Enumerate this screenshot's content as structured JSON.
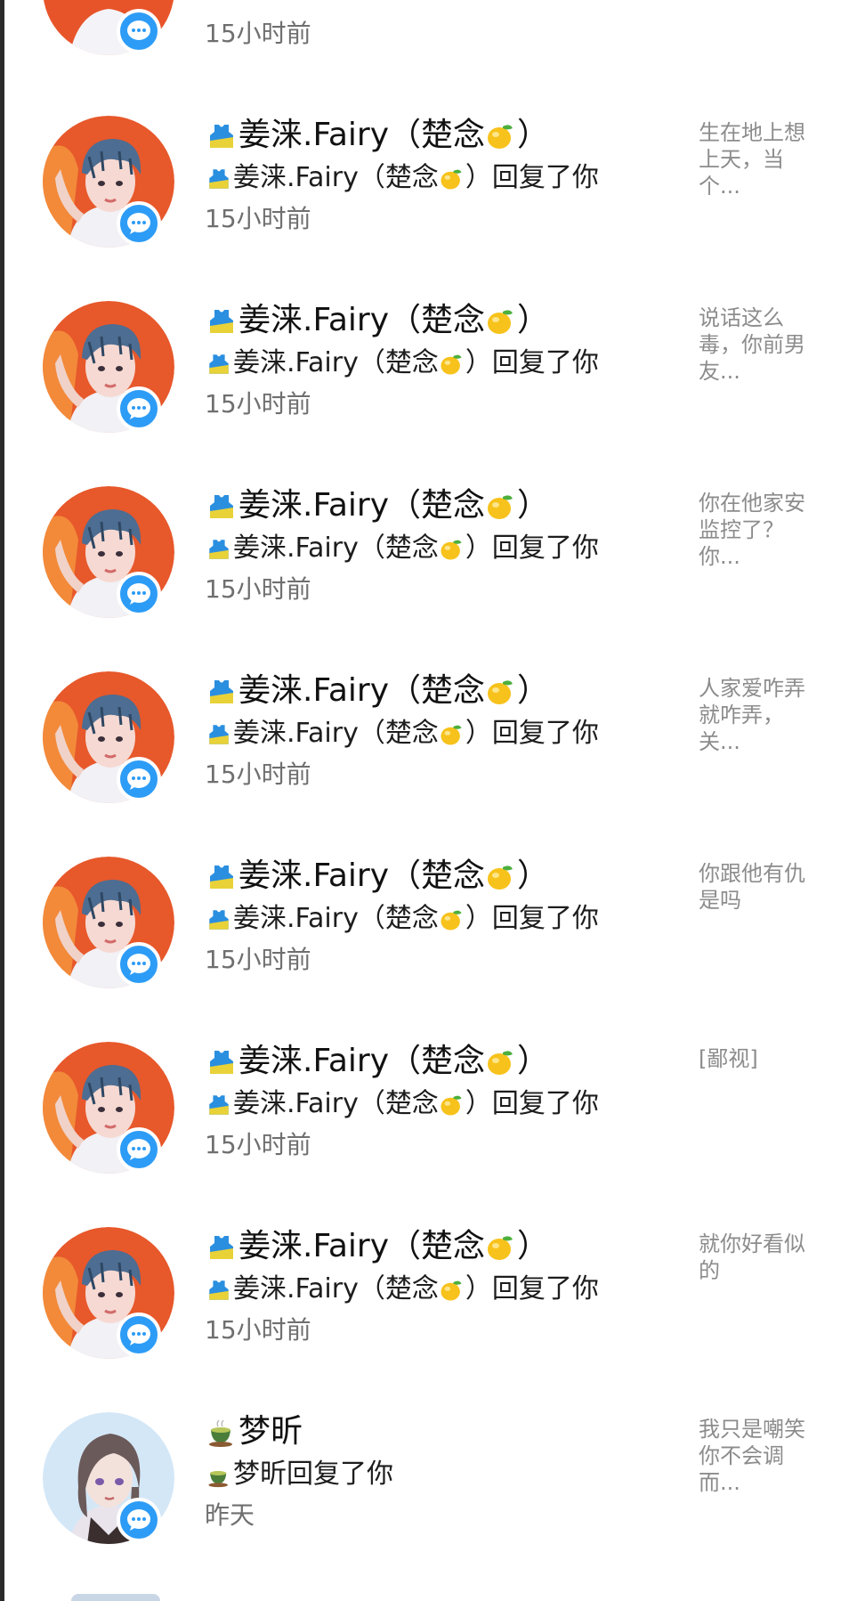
{
  "rows_top_partial": {
    "time": "15小时前"
  },
  "rows": [
    {
      "avatar": "boy-avatar",
      "badge": "chat-bubble-icon",
      "name_emoji": "shirt-emoji",
      "name": "姜涞.Fairy（楚念",
      "name_end_emoji": "mango-emoji",
      "name_close": "）",
      "action_prefix": "姜涞.Fairy（楚念",
      "action_suffix": "）回复了你",
      "time": "15小时前",
      "quote": "生在地上想上天，当个..."
    },
    {
      "avatar": "boy-avatar",
      "badge": "chat-bubble-icon",
      "name_emoji": "shirt-emoji",
      "name": "姜涞.Fairy（楚念",
      "name_end_emoji": "mango-emoji",
      "name_close": "）",
      "action_prefix": "姜涞.Fairy（楚念",
      "action_suffix": "）回复了你",
      "time": "15小时前",
      "quote": "说话这么毒，你前男友..."
    },
    {
      "avatar": "boy-avatar",
      "badge": "chat-bubble-icon",
      "name_emoji": "shirt-emoji",
      "name": "姜涞.Fairy（楚念",
      "name_end_emoji": "mango-emoji",
      "name_close": "）",
      "action_prefix": "姜涞.Fairy（楚念",
      "action_suffix": "）回复了你",
      "time": "15小时前",
      "quote": "你在他家安监控了？你..."
    },
    {
      "avatar": "boy-avatar",
      "badge": "chat-bubble-icon",
      "name_emoji": "shirt-emoji",
      "name": "姜涞.Fairy（楚念",
      "name_end_emoji": "mango-emoji",
      "name_close": "）",
      "action_prefix": "姜涞.Fairy（楚念",
      "action_suffix": "）回复了你",
      "time": "15小时前",
      "quote": "人家爱咋弄就咋弄，关..."
    },
    {
      "avatar": "boy-avatar",
      "badge": "chat-bubble-icon",
      "name_emoji": "shirt-emoji",
      "name": "姜涞.Fairy（楚念",
      "name_end_emoji": "mango-emoji",
      "name_close": "）",
      "action_prefix": "姜涞.Fairy（楚念",
      "action_suffix": "）回复了你",
      "time": "15小时前",
      "quote": "你跟他有仇是吗"
    },
    {
      "avatar": "boy-avatar",
      "badge": "chat-bubble-icon",
      "name_emoji": "shirt-emoji",
      "name": "姜涞.Fairy（楚念",
      "name_end_emoji": "mango-emoji",
      "name_close": "）",
      "action_prefix": "姜涞.Fairy（楚念",
      "action_suffix": "）回复了你",
      "time": "15小时前",
      "quote": "[鄙视]"
    },
    {
      "avatar": "boy-avatar",
      "badge": "chat-bubble-icon",
      "name_emoji": "shirt-emoji",
      "name": "姜涞.Fairy（楚念",
      "name_end_emoji": "mango-emoji",
      "name_close": "）",
      "action_prefix": "姜涞.Fairy（楚念",
      "action_suffix": "）回复了你",
      "time": "15小时前",
      "quote": "就你好看似的"
    },
    {
      "avatar": "anime-girl-avatar",
      "badge": "chat-bubble-icon",
      "name_emoji": "tea-emoji",
      "name": "梦昕",
      "name_end_emoji": "",
      "name_close": "",
      "action_prefix": "梦昕",
      "action_suffix": "回复了你",
      "time": "昨天",
      "quote": "我只是嘲笑你不会调而..."
    }
  ],
  "colors": {
    "badge": "#2d9cf6",
    "name": "#111111",
    "action": "#1d1d1d",
    "time": "#6f6f6f",
    "quote": "#8c8c8c"
  }
}
